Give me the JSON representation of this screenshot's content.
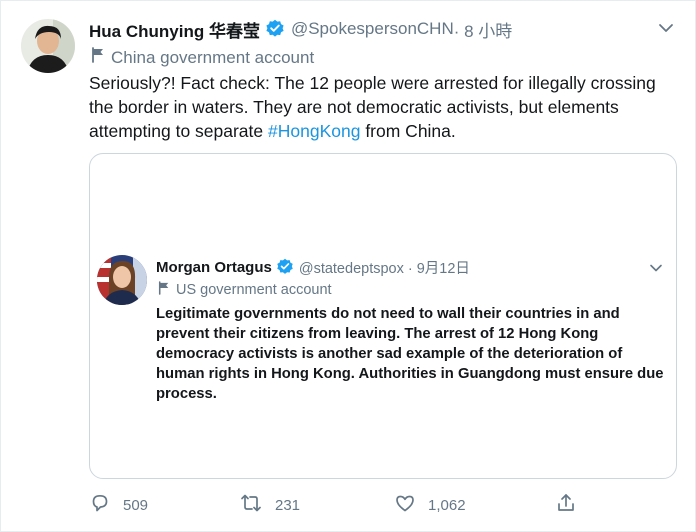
{
  "tweet": {
    "author": {
      "display_name": "Hua Chunying 华春莹",
      "handle": "@SpokespersonCHN",
      "time": " · 8 小時",
      "label": "China government account"
    },
    "text_before": "Seriously?! Fact check: The 12 people were arrested for illegally crossing the border in waters. They are not democratic activists, but elements attempting to separate ",
    "hashtag": "#HongKong",
    "text_after": " from China."
  },
  "quoted": {
    "author": {
      "display_name": "Morgan Ortagus",
      "handle": "@statedeptspox · 9月12日",
      "label": "US government account"
    },
    "text": "Legitimate governments do not need to wall their countries in and prevent their citizens from leaving. The arrest of 12 Hong Kong democracy activists is another sad example of the deterioration of human rights in Hong Kong. Authorities in Guangdong must ensure due process."
  },
  "actions": {
    "replies": "509",
    "retweets": "231",
    "likes": "1,062"
  },
  "colors": {
    "verified": "#1da1f2",
    "hashtag": "#1b95e0",
    "secondary_text": "#657786",
    "border": "#ccd6dd"
  },
  "icons": {
    "verified": "verified-badge-icon",
    "flag": "flag-icon",
    "caret": "chevron-down-icon",
    "reply": "reply-icon",
    "retweet": "retweet-icon",
    "like": "heart-icon",
    "share": "share-icon"
  }
}
